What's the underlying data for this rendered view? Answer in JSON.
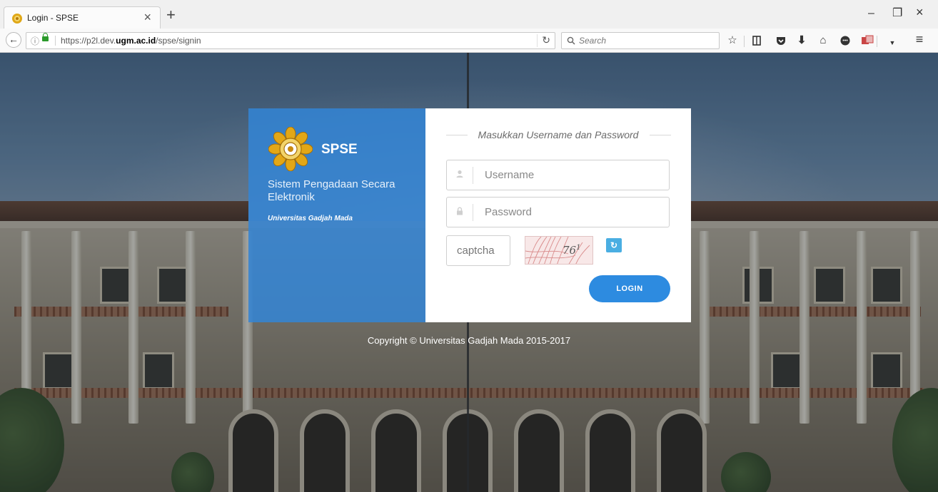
{
  "browser": {
    "tab_title": "Login - SPSE",
    "tab_close": "×",
    "new_tab": "+",
    "url_prefix": "https://p2l.dev.",
    "url_domain": "ugm.ac.id",
    "url_path": "/spse/signin",
    "search_placeholder": "Search",
    "window_minimize": "–",
    "window_restore": "❐",
    "window_close": "×",
    "icons": [
      "back-icon",
      "info-icon",
      "lock-icon",
      "reload-icon",
      "search-icon",
      "bookmark-star-icon",
      "reading-list-icon",
      "pocket-icon",
      "download-icon",
      "home-icon",
      "chat-icon",
      "extension-icon",
      "menu-icon"
    ]
  },
  "brand": {
    "name": "SPSE",
    "subtitle": "Sistem Pengadaan Secara Elektronik",
    "university": "Universitas Gadjah Mada",
    "panel_color": "#3285d6"
  },
  "form": {
    "heading": "Masukkan Username dan Password",
    "username_placeholder": "Username",
    "password_placeholder": "Password",
    "captcha_placeholder": "captcha",
    "captcha_code": "76",
    "captcha_superscript": "1",
    "refresh_icon": "↻",
    "login_label": "LOGIN",
    "button_color": "#2d8be0"
  },
  "footer": {
    "copyright": "Copyright © Universitas Gadjah Mada 2015-2017"
  }
}
